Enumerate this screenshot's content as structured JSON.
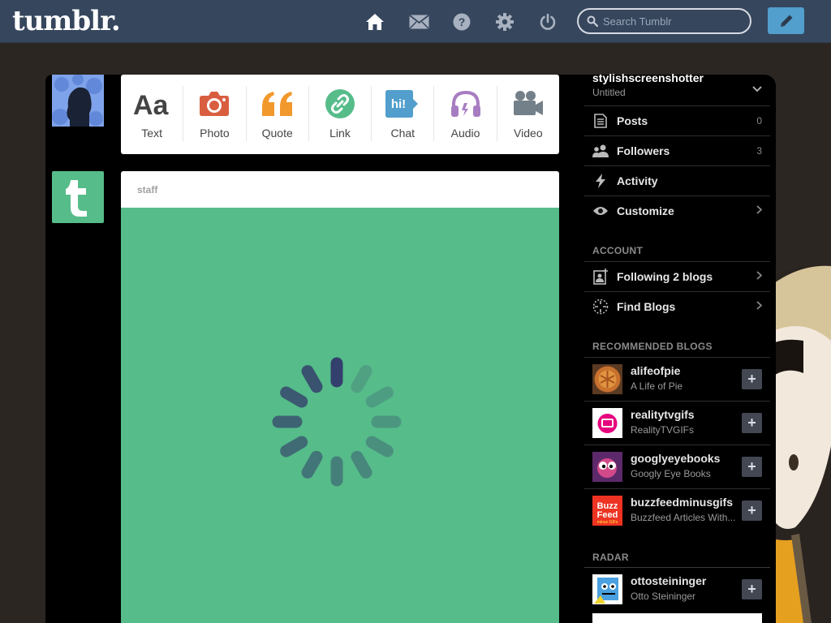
{
  "header": {
    "logo": "tumblr.",
    "search_placeholder": "Search Tumblr",
    "icons": [
      "home-icon",
      "mail-icon",
      "help-icon",
      "settings-icon",
      "power-icon",
      "pencil-icon"
    ]
  },
  "post_types": [
    {
      "label": "Text",
      "icon": "text-icon",
      "color": "#444444"
    },
    {
      "label": "Photo",
      "icon": "camera-icon",
      "color": "#d95e40"
    },
    {
      "label": "Quote",
      "icon": "quote-icon",
      "color": "#f2992e"
    },
    {
      "label": "Link",
      "icon": "link-icon",
      "color": "#56bc8a"
    },
    {
      "label": "Chat",
      "icon": "chat-icon",
      "color": "#529ecc"
    },
    {
      "label": "Audio",
      "icon": "headphones-icon",
      "color": "#a77dc2"
    },
    {
      "label": "Video",
      "icon": "video-icon",
      "color": "#748089"
    }
  ],
  "post": {
    "author": "staff",
    "accent_color": "#56bc8a"
  },
  "sidebar": {
    "blog_name": "stylishscreenshotter",
    "blog_subtitle": "Untitled",
    "menu": [
      {
        "label": "Posts",
        "count": "0",
        "icon": "document-icon"
      },
      {
        "label": "Followers",
        "count": "3",
        "icon": "people-icon"
      },
      {
        "label": "Activity",
        "count": "",
        "icon": "lightning-icon"
      },
      {
        "label": "Customize",
        "count": "",
        "icon": "eye-icon"
      }
    ],
    "account_title": "ACCOUNT",
    "account_items": [
      {
        "label": "Following 2 blogs",
        "icon": "add-person-icon"
      },
      {
        "label": "Find Blogs",
        "icon": "compass-icon"
      }
    ],
    "recommended_title": "RECOMMENDED BLOGS",
    "recommended": [
      {
        "name": "alifeofpie",
        "subtitle": "A Life of Pie"
      },
      {
        "name": "realitytvgifs",
        "subtitle": "RealityTVGIFs"
      },
      {
        "name": "googlyeyebooks",
        "subtitle": "Googly Eye Books"
      },
      {
        "name": "buzzfeedminusgifs",
        "subtitle": "Buzzfeed Articles With..."
      }
    ],
    "radar_title": "RADAR",
    "radar": {
      "name": "ottosteininger",
      "subtitle": "Otto Steininger"
    }
  }
}
